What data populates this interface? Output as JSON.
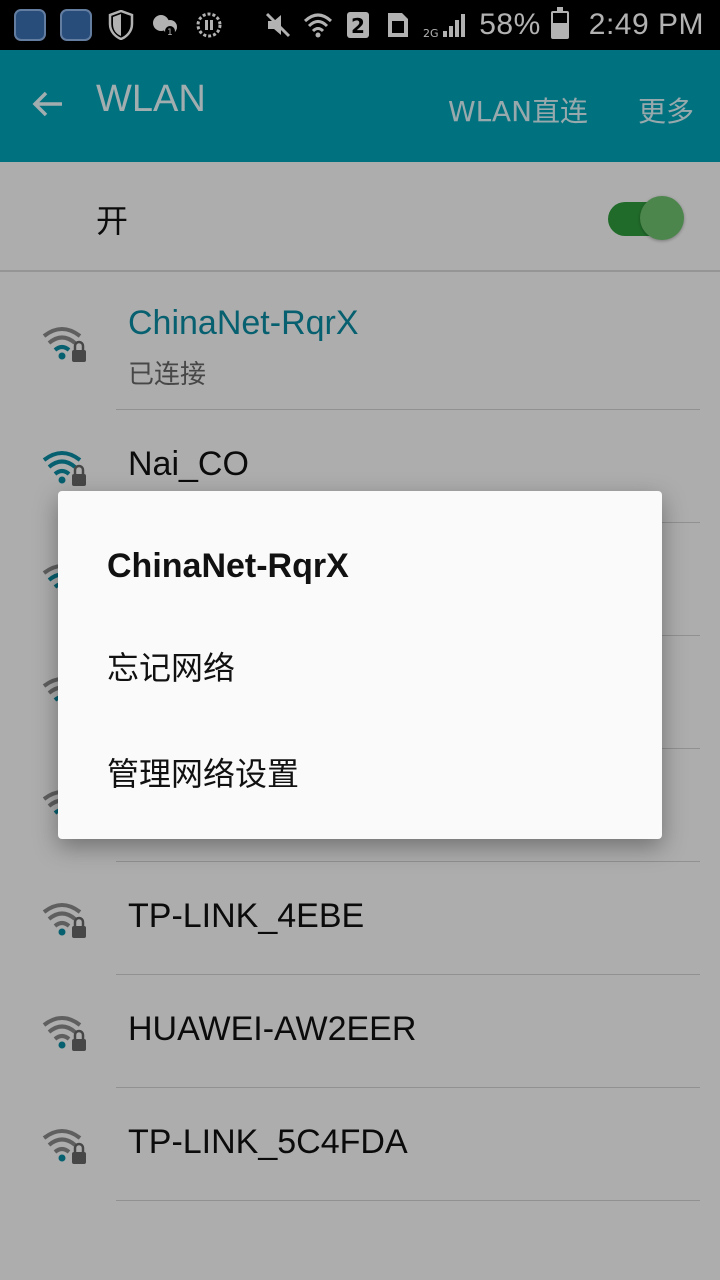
{
  "status_bar": {
    "battery": "58%",
    "time": "2:49 PM",
    "sim_slot": "2",
    "network_type": "2G",
    "icons": [
      "app-icon-1",
      "app-icon-2",
      "shield-icon",
      "cloud-icon",
      "pause-circle-icon",
      "mute-icon",
      "wifi-signal-icon",
      "sim-icon",
      "cell-signal-icon",
      "battery-icon"
    ]
  },
  "app_bar": {
    "title": "WLAN",
    "action_direct": "WLAN直连",
    "action_more": "更多"
  },
  "toggle": {
    "label": "开",
    "on": true
  },
  "networks": [
    {
      "name": "ChinaNet-RqrX",
      "status": "已连接"
    },
    {
      "name": "Nai_CO"
    },
    {
      "name": ""
    },
    {
      "name": ""
    },
    {
      "name": ""
    },
    {
      "name": "TP-LINK_4EBE"
    },
    {
      "name": "HUAWEI-AW2EER"
    },
    {
      "name": "TP-LINK_5C4FDA"
    }
  ],
  "dialog": {
    "title": "ChinaNet-RqrX",
    "option_forget": "忘记网络",
    "option_manage": "管理网络设置"
  },
  "colors": {
    "app_bar": "#00a2b6",
    "connected_text": "#0b8aa0",
    "switch_on": "#2f9a3d"
  }
}
